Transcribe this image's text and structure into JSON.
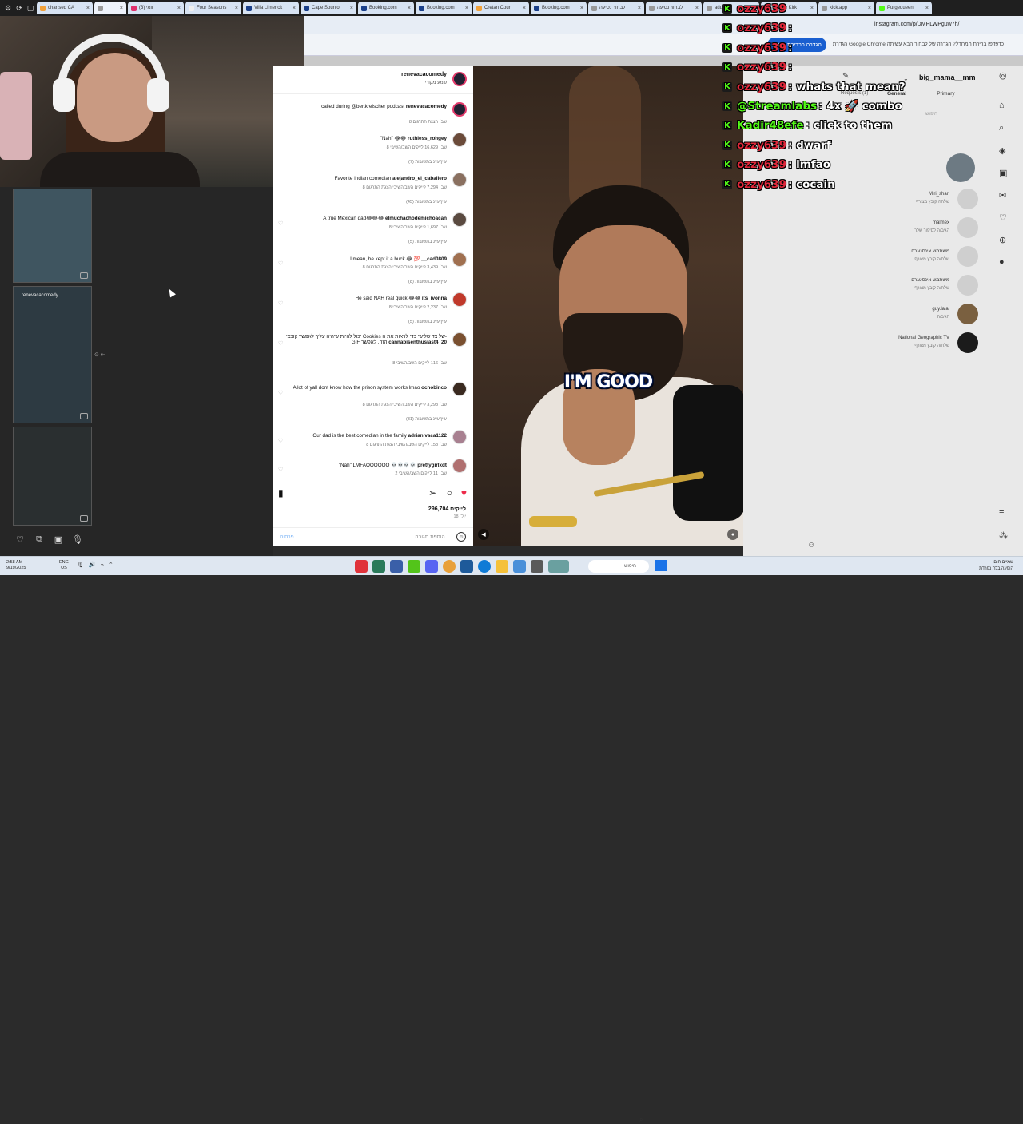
{
  "browser": {
    "tabs": [
      {
        "label": "chartsed CA",
        "active": false
      },
      {
        "label": "",
        "active": true
      },
      {
        "label": "(3) וואי",
        "active": false
      },
      {
        "label": "Four Seasons",
        "active": false
      },
      {
        "label": "Villa Limerick",
        "active": false
      },
      {
        "label": "Cape Sounio",
        "active": false
      },
      {
        "label": "Booking.com",
        "active": false
      },
      {
        "label": "Booking.com",
        "active": false
      },
      {
        "label": "Cretan Coun",
        "active": false
      },
      {
        "label": "Booking.com",
        "active": false
      },
      {
        "label": "לבחור נסיעה",
        "active": false
      },
      {
        "label": "לבחור נסיעה",
        "active": false
      },
      {
        "label": "adult",
        "active": false
      },
      {
        "label": "Charlie Kirk",
        "active": false
      },
      {
        "label": "kick.app",
        "active": false
      },
      {
        "label": "Purgequeen",
        "active": false
      }
    ],
    "url": "instagram.com/p/DMPLWPguw7h/",
    "info_text": "הגדרת Google Chrome כדפדפן ברירת המחדל? הגדרה של לבחור הבא עשיתה",
    "info_button": "הגדרה כברירת מחדל"
  },
  "stream_thumbs": {
    "username": "renevacacomedy"
  },
  "instagram_post": {
    "author": "renevacacomedy",
    "author_sub": "שמע מקורי",
    "caption": "called during @bertkreischer podcast",
    "caption_mention": "@bertkreischer",
    "caption_meta": "8 שב׳  הצגת התרגום",
    "comments": [
      {
        "user": "ruthless_rohgey",
        "text": "\"Nah\" 😂😂",
        "meta": "8 שב׳  16,629 לייקים  השב/השיבי",
        "replies": "עיין/עיינ בתשובות (7)"
      },
      {
        "user": "alejandro_el_caballero",
        "text": "Favorite Indian comedian",
        "meta": "8 שב׳  7,294 לייקים  השב/השיבי  הצגת התרגום",
        "replies": "עיין/עיינ בתשובות (45)"
      },
      {
        "user": "elmuchachodemichoacan",
        "text": "A true Mexican dad😂😂😂",
        "meta": "8 שב׳  1,697 לייקים  השב/השיבי",
        "replies": "עיין/עיינ בתשובות (5)"
      },
      {
        "user": "__cad0809",
        "text": "I mean, he kept it a buck 😂 💯",
        "meta": "8 שב׳  3,439 לייקים  השב/השיבי  הצגת התרגום",
        "replies": "עיין/עיינ בתשובות (8)"
      },
      {
        "user": "its_ivonna",
        "text": "He said NAH real quick 😂😂",
        "meta": "8 שב׳  2,237 לייקים  השב/השיבי",
        "replies": "עיין/עיינ בתשובות (5)"
      },
      {
        "user": "cannabisenthusiast4_20",
        "text": "יכול להיות שיהיה עליך לאפשר קובצי Cookies של צד שלישי כדי לראות את ה-GIF הזה. לאפשר",
        "meta": "8 שב׳  116 לייקים  השב/השיבי",
        "replies": ""
      },
      {
        "user": "ochobinco",
        "text": "A lot of yall dont know how the prison system works lmao",
        "meta": "8 שב׳  3,298 לייקים  השב/השיבי  הצגת התרגום",
        "replies": "עיין/עיינ בתשובות (31)"
      },
      {
        "user": "adrian.vaca1122",
        "text": "Our dad is the best comedian in the family",
        "meta": "8 שב׳  158 לייקים  השב/השיבי  הצגת התרגום",
        "replies": ""
      },
      {
        "user": "prettygirlxdt",
        "text": "\"Nah\" LMFAOOOOOO 💀💀💀💀",
        "meta": "2 שב׳  11 לייקים  השב/השיבי",
        "replies": ""
      }
    ],
    "likes": "296,704 לייקים",
    "ago": "18 יול׳",
    "input_placeholder": "הוספת תגובה...",
    "post_label": "פרסום"
  },
  "video": {
    "caption": "I'M GOOD"
  },
  "dms": {
    "username": "big_mama__mm",
    "tabs": [
      "General",
      "Primary"
    ],
    "requests_label": "Requests (1)",
    "search_placeholder": "חיפוש",
    "items": [
      {
        "name": "Miri_shari",
        "sub": "שלחה קובץ מצורף"
      },
      {
        "name": "malmex",
        "sub": "הגיב/ה לסיפור שלך"
      },
      {
        "name": "משתמש אינסטגרם",
        "sub": "שלח/ה קובץ מצורף"
      },
      {
        "name": "משתמש אינסטגרם",
        "sub": "שלח/ה קובץ מצורף"
      },
      {
        "name": "guy.lalal",
        "sub": "הגיב/ה"
      },
      {
        "name": "National Geographic TV",
        "sub": "שלח/ה קובץ מצורף"
      }
    ]
  },
  "chat": {
    "colors": {
      "ozzy": "#e0273a",
      "streamlabs": "#53fc18",
      "kadir": "#53fc18"
    },
    "lines": [
      {
        "user": "ozzy639",
        "msg": " ",
        "color": "ozzy"
      },
      {
        "user": "ozzy639",
        "msg": ":",
        "color": "ozzy"
      },
      {
        "user": "ozzy639",
        "msg": ":",
        "color": "ozzy"
      },
      {
        "user": "ozzy639",
        "msg": ":",
        "color": "ozzy"
      },
      {
        "user": "ozzy639",
        "msg": ": whats that mean?",
        "color": "ozzy"
      },
      {
        "user": "@Streamlabs",
        "msg": ": 4x 🚀 combo",
        "color": "streamlabs"
      },
      {
        "user": "Kadir48efe",
        "msg": ": click to them",
        "color": "kadir"
      },
      {
        "user": "ozzy639",
        "msg": ": dwarf",
        "color": "ozzy"
      },
      {
        "user": "ozzy639",
        "msg": ": lmfao",
        "color": "ozzy"
      },
      {
        "user": "ozzy639",
        "msg": ": cocain",
        "color": "ozzy"
      }
    ]
  },
  "taskbar": {
    "time": "2:58 AM",
    "date": "9/19/2025",
    "lang": "ENG",
    "region": "US",
    "search": "חיפוש",
    "weather_title": "שמיים חום",
    "weather_sub": "הופעה בלת נפרדת"
  }
}
